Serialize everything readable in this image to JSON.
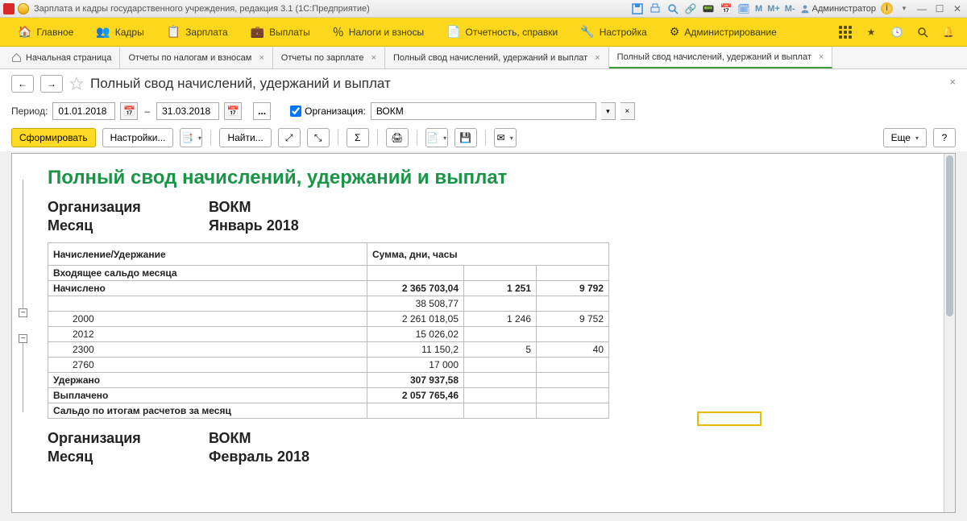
{
  "titlebar": {
    "app_title": "Зарплата и кадры государственного учреждения, редакция 3.1  (1С:Предприятие)",
    "user": "Администратор",
    "m_labels": [
      "M",
      "M+",
      "M-"
    ]
  },
  "mainmenu": {
    "items": [
      {
        "label": "Главное"
      },
      {
        "label": "Кадры"
      },
      {
        "label": "Зарплата"
      },
      {
        "label": "Выплаты"
      },
      {
        "label": "Налоги и взносы"
      },
      {
        "label": "Отчетность, справки"
      },
      {
        "label": "Настройка"
      },
      {
        "label": "Администрирование"
      }
    ]
  },
  "tabs": [
    {
      "label": "Начальная страница",
      "home": true,
      "closable": false
    },
    {
      "label": "Отчеты по налогам и взносам",
      "closable": true
    },
    {
      "label": "Отчеты по зарплате",
      "closable": true
    },
    {
      "label": "Полный свод начислений, удержаний и выплат",
      "closable": true
    },
    {
      "label": "Полный свод начислений, удержаний и выплат",
      "closable": true,
      "active": true
    }
  ],
  "page": {
    "title": "Полный свод начислений, удержаний и выплат"
  },
  "filter": {
    "period_label": "Период:",
    "date_from": "01.01.2018",
    "date_to": "31.03.2018",
    "org_label": "Организация:",
    "org_value": "ВОКМ"
  },
  "toolbar": {
    "generate": "Сформировать",
    "settings": "Настройки...",
    "find": "Найти...",
    "more": "Еще"
  },
  "report": {
    "title": "Полный свод начислений, удержаний и выплат",
    "blocks": [
      {
        "org_label": "Организация",
        "org_value": "ВОКМ",
        "month_label": "Месяц",
        "month_value": "Январь 2018",
        "header": {
          "c1": "Начисление/Удержание",
          "c2": "Сумма, дни, часы"
        },
        "rows": [
          {
            "c1": "Входящее сальдо месяца",
            "bold": true
          },
          {
            "c1": "Начислено",
            "c2": "2 365 703,04",
            "c3": "1 251",
            "c4": "9 792",
            "bold": true
          },
          {
            "c1": "",
            "c2": "38 508,77",
            "ind": 1
          },
          {
            "c1": "2000",
            "c2": "2 261 018,05",
            "c3": "1 246",
            "c4": "9 752",
            "ind": 2
          },
          {
            "c1": "2012",
            "c2": "15 026,02",
            "ind": 2
          },
          {
            "c1": "2300",
            "c2": "11 150,2",
            "c3": "5",
            "c4": "40",
            "ind": 2
          },
          {
            "c1": "2760",
            "c2": "17 000",
            "ind": 2
          },
          {
            "c1": "Удержано",
            "c2": "307 937,58",
            "bold": true
          },
          {
            "c1": "Выплачено",
            "c2": "2 057 765,46",
            "bold": true
          },
          {
            "c1": "Сальдо по итогам расчетов за месяц",
            "bold": true
          }
        ]
      },
      {
        "org_label": "Организация",
        "org_value": "ВОКМ",
        "month_label": "Месяц",
        "month_value": "Февраль 2018"
      }
    ]
  }
}
